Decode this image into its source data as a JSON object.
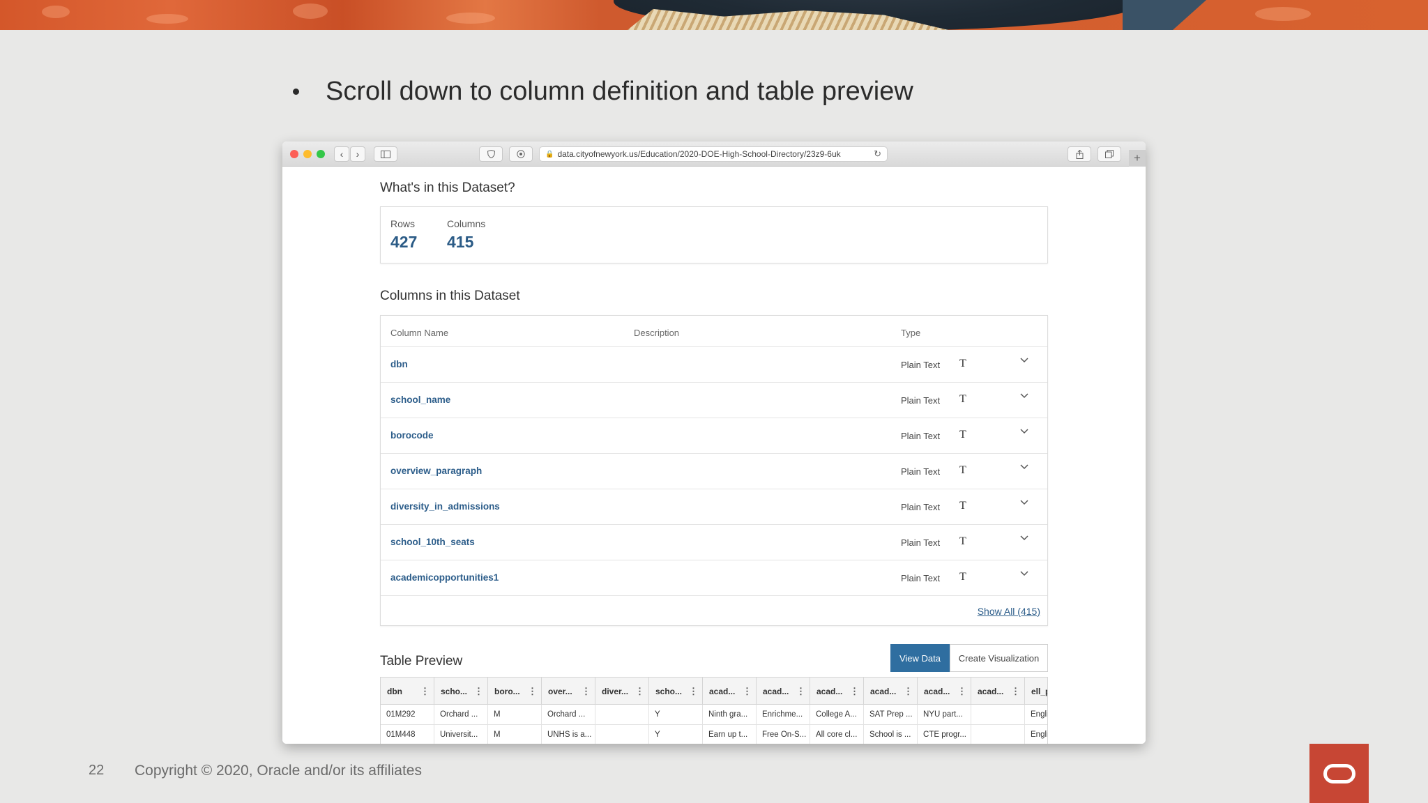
{
  "slide": {
    "bullet_text": "Scroll down to column definition and table preview",
    "page_number": "22",
    "copyright": "Copyright © 2020, Oracle and/or its affiliates",
    "brand_color": "#c74634"
  },
  "browser": {
    "url": "data.cityofnewyork.us/Education/2020-DOE-High-School-Directory/23z9-6uk",
    "back_icon": "‹",
    "forward_icon": "›",
    "new_tab_icon": "+"
  },
  "dataset": {
    "heading": "What's in this Dataset?",
    "rows_label": "Rows",
    "rows_value": "427",
    "columns_label": "Columns",
    "columns_value": "415"
  },
  "columns_section": {
    "heading": "Columns in this Dataset",
    "header_name": "Column Name",
    "header_description": "Description",
    "header_type": "Type",
    "rows": [
      {
        "name": "dbn",
        "type": "Plain Text",
        "type_icon": "T"
      },
      {
        "name": "school_name",
        "type": "Plain Text",
        "type_icon": "T"
      },
      {
        "name": "borocode",
        "type": "Plain Text",
        "type_icon": "T"
      },
      {
        "name": "overview_paragraph",
        "type": "Plain Text",
        "type_icon": "T"
      },
      {
        "name": "diversity_in_admissions",
        "type": "Plain Text",
        "type_icon": "T"
      },
      {
        "name": "school_10th_seats",
        "type": "Plain Text",
        "type_icon": "T"
      },
      {
        "name": "academicopportunities1",
        "type": "Plain Text",
        "type_icon": "T"
      }
    ],
    "show_all": "Show All (415)"
  },
  "preview": {
    "heading": "Table Preview",
    "view_data": "View Data",
    "create_viz": "Create Visualization",
    "headers": [
      "dbn",
      "scho...",
      "boro...",
      "over...",
      "diver...",
      "scho...",
      "acad...",
      "acad...",
      "acad...",
      "acad...",
      "acad...",
      "acad...",
      "ell_p"
    ],
    "rows": [
      [
        "01M292",
        "Orchard ...",
        "M",
        "Orchard ...",
        "",
        "Y",
        "Ninth gra...",
        "Enrichme...",
        "College A...",
        "SAT Prep ...",
        "NYU part...",
        "",
        "Engli"
      ],
      [
        "01M448",
        "Universit...",
        "M",
        "UNHS is a...",
        "",
        "Y",
        "Earn up t...",
        "Free On-S...",
        "All core cl...",
        "School is ...",
        "CTE progr...",
        "",
        "Engli"
      ]
    ]
  }
}
